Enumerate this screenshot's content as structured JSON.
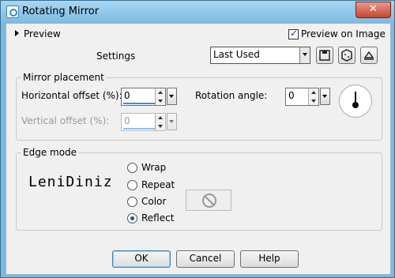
{
  "window": {
    "title": "Rotating Mirror",
    "close_label": "✕"
  },
  "top": {
    "preview_label": "Preview",
    "preview_on_image_label": "Preview on Image",
    "preview_on_image_checked": true,
    "settings_label": "Settings",
    "settings_value": "Last Used"
  },
  "toolbar_icons": [
    "save-icon",
    "cube-icon",
    "reset-icon"
  ],
  "mirror_placement": {
    "legend": "Mirror placement",
    "horizontal_offset_label": "Horizontal offset (%):",
    "horizontal_offset_value": "0",
    "vertical_offset_label": "Vertical offset (%):",
    "vertical_offset_value": "0",
    "rotation_angle_label": "Rotation angle:",
    "rotation_angle_value": "0"
  },
  "edge_mode": {
    "legend": "Edge mode",
    "options": [
      "Wrap",
      "Repeat",
      "Color",
      "Reflect"
    ],
    "selected": "Reflect"
  },
  "signature": "LeniDiniz",
  "buttons": {
    "ok": "OK",
    "cancel": "Cancel",
    "help": "Help"
  }
}
